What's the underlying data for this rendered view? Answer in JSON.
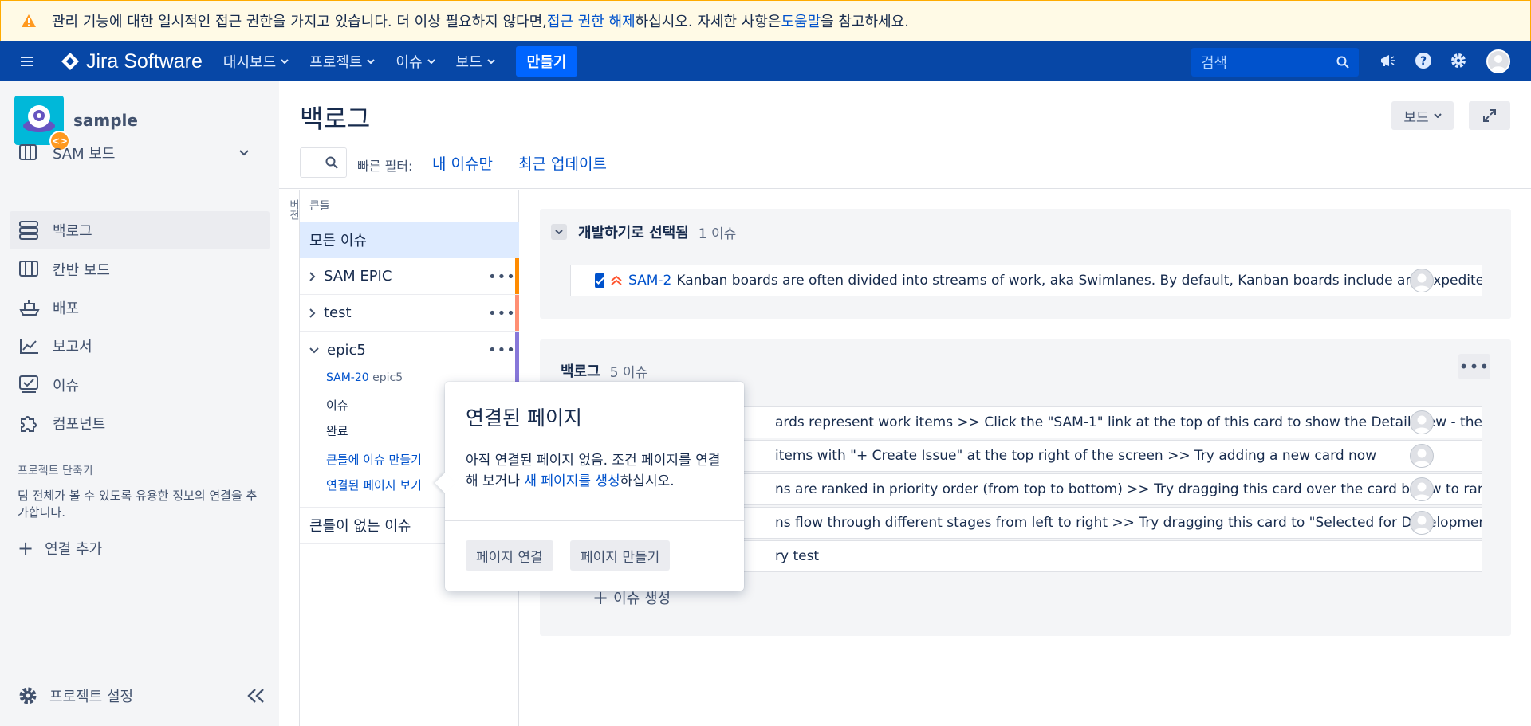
{
  "banner": {
    "text_before": "관리 기능에 대한 일시적인 접근 권한을 가지고 있습니다. 더 이상 필요하지 않다면, ",
    "revoke_link": "접근 권한 해제",
    "text_middle": "하십시오. 자세한 사항은 ",
    "help_link": "도움말",
    "text_after": "을 참고하세요."
  },
  "topnav": {
    "logo": "Jira Software",
    "menu": [
      "대시보드",
      "프로젝트",
      "이슈",
      "보드"
    ],
    "create": "만들기",
    "search_placeholder": "검색"
  },
  "sidebar": {
    "project_name": "sample",
    "board_selector": "SAM 보드",
    "items": [
      "백로그",
      "칸반 보드",
      "배포",
      "보고서",
      "이슈",
      "컴포넌트"
    ],
    "shortcuts_title": "프로젝트 단축키",
    "shortcuts_desc": "팀 전체가 볼 수 있도록 유용한 정보의 연결을 추가합니다.",
    "add_link": "연결 추가",
    "settings": "프로젝트 설정"
  },
  "main": {
    "title": "백로그",
    "board_button": "보드",
    "quick_filter_label": "빠른 필터:",
    "filters": [
      "내 이슈만",
      "최근 업데이트"
    ]
  },
  "epic_panel": {
    "vertical_label": "버전",
    "label": "큰틀",
    "all_issues": "모든 이슈",
    "epics": [
      {
        "name": "SAM EPIC",
        "color": "#ff8b00"
      },
      {
        "name": "test",
        "color": "#ff8f73"
      },
      {
        "name": "epic5",
        "color": "#8777d9"
      }
    ],
    "epic5_detail": {
      "issue_key": "SAM-20",
      "issue_epic": "epic5",
      "issues_label": "이슈",
      "done_label": "완료",
      "create_link": "큰틀에 이슈 만들기",
      "linked_link": "연결된 페이지 보기"
    },
    "no_epic": "큰틀이 없는 이슈"
  },
  "sprint": {
    "title": "개발하기로 선택됨",
    "count": "1 이슈",
    "issue": {
      "key": "SAM-2",
      "summary": "Kanban boards are often divided into streams of work, aka Swimlanes. By default, Kanban boards include an \"Expedite..."
    }
  },
  "backlog": {
    "title": "백로그",
    "count": "5 이슈",
    "issues": [
      "ards represent work items >> Click the \"SAM-1\" link at the top of this card to show the Detail view - there's ...",
      " items with \"+ Create Issue\" at the top right of the screen >> Try adding a new card now",
      "ns are ranked in priority order (from top to bottom) >> Try dragging this card over the card below to rank its...",
      "ns flow through different stages from left to right >> Try dragging this card to \"Selected for Development\"",
      "ry test"
    ],
    "create_issue": "이슈 생성"
  },
  "popover": {
    "title": "연결된 페이지",
    "body_before": "아직 연결된 페이지 없음. 조건 페이지를 연결해 보거나 ",
    "body_link": "새 페이지를 생성",
    "body_after": "하십시오.",
    "btn_link": "페이지 연결",
    "btn_create": "페이지 만들기"
  }
}
